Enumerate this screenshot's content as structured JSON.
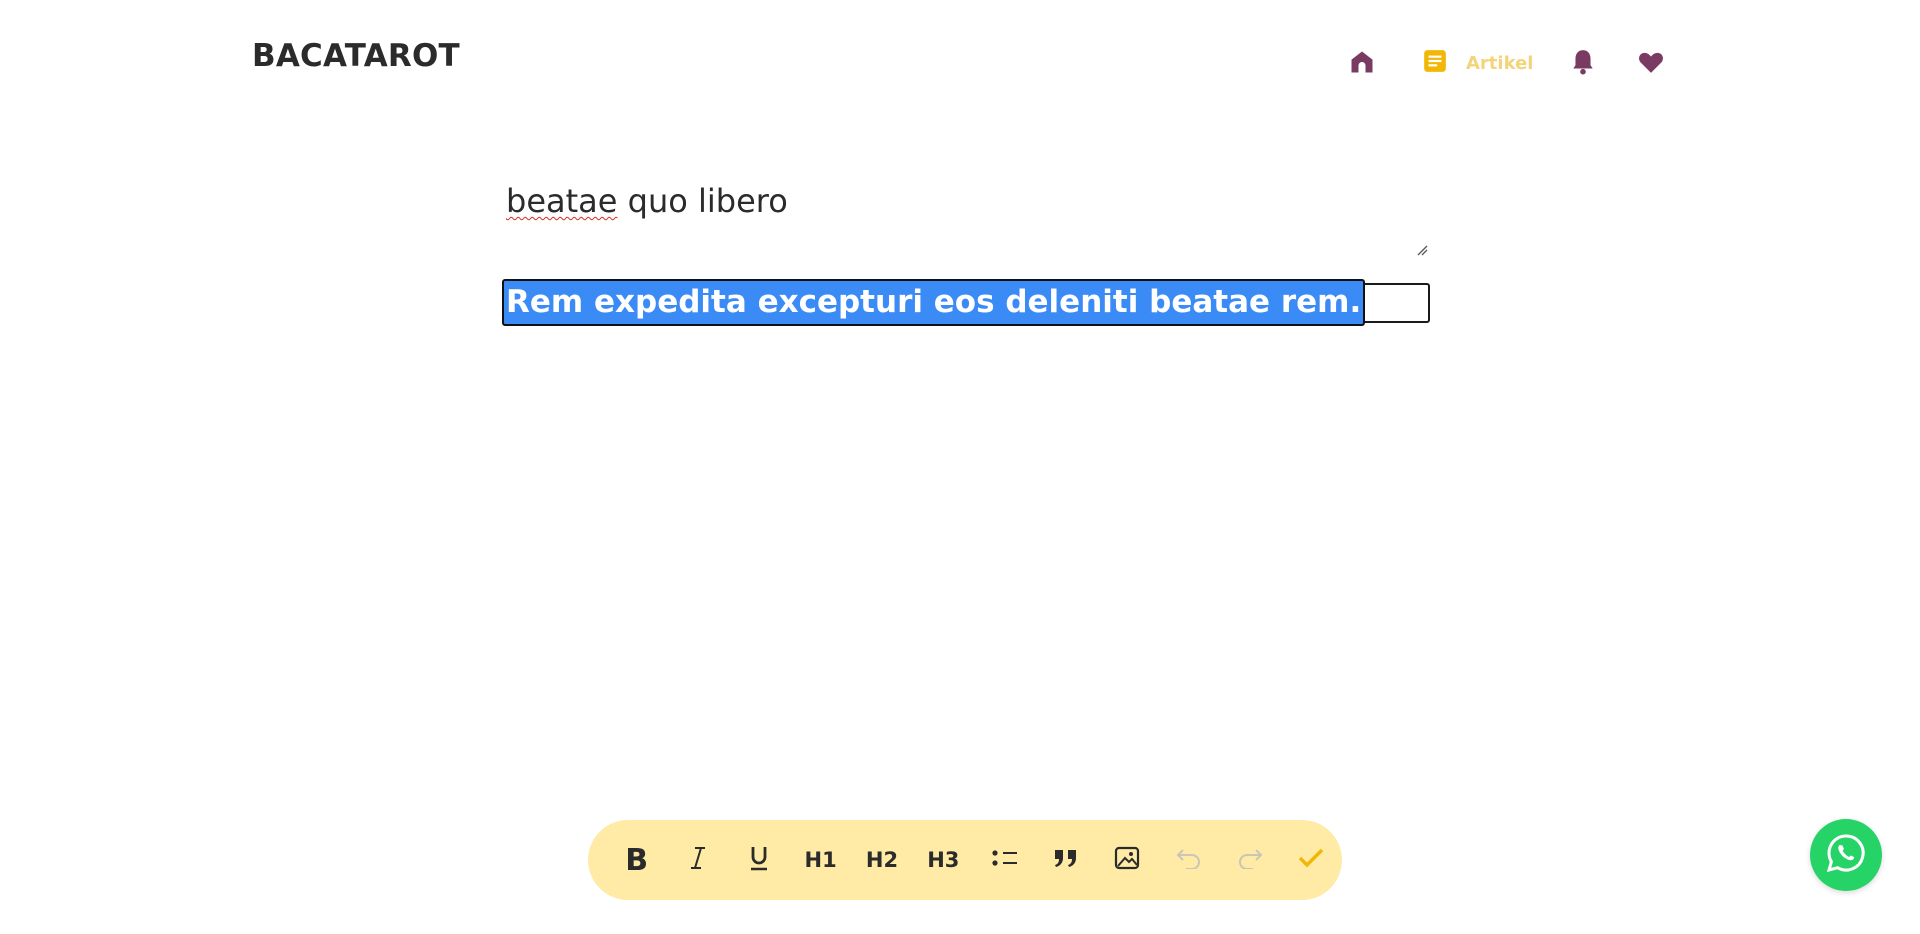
{
  "header": {
    "logo": "BACATAROT",
    "nav": {
      "home_icon": "home-icon",
      "artikel_icon": "article-icon",
      "artikel_label": "Artikel",
      "bell_icon": "bell-icon",
      "heart_icon": "heart-icon"
    }
  },
  "editor": {
    "title_word1": "beatae",
    "title_rest": " quo libero",
    "subtitle_selected": "Rem expedita excepturi eos deleniti beatae rem."
  },
  "toolbar": {
    "bold": "B",
    "h1": "H1",
    "h2": "H2",
    "h3": "H3",
    "icons": [
      "bold-icon",
      "italic-icon",
      "underline-icon",
      "h1",
      "h2",
      "h3",
      "bullet-list-icon",
      "quote-icon",
      "image-icon",
      "undo-icon",
      "redo-icon",
      "check-icon"
    ]
  },
  "colors": {
    "brand_purple": "#7a3b63",
    "accent_yellow": "#f2b705",
    "toolbar_bg": "#ffeaa6",
    "selection_blue": "#3b8bf7",
    "whatsapp_green": "#25d366"
  }
}
